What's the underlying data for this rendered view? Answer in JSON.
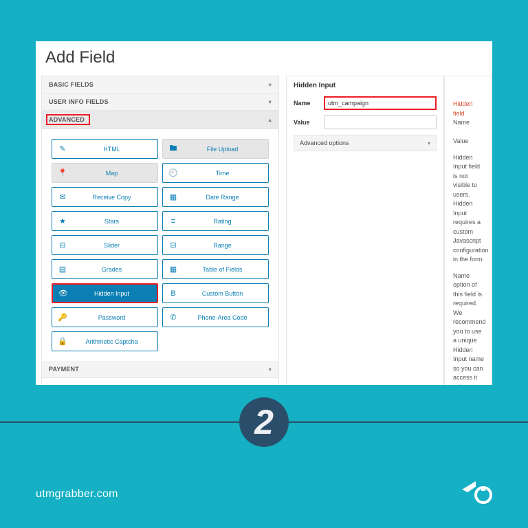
{
  "window": {
    "title": "Add Field"
  },
  "accordions": {
    "basic": "BASIC FIELDS",
    "user": "USER INFO FIELDS",
    "advanced": "ADVANCED",
    "payment": "PAYMENT"
  },
  "fields": [
    {
      "id": "html",
      "label": "HTML",
      "icon": "✎",
      "state": "normal"
    },
    {
      "id": "file",
      "label": "File Upload",
      "icon": "🖿",
      "state": "disabled"
    },
    {
      "id": "map",
      "label": "Map",
      "icon": "📍",
      "state": "disabled"
    },
    {
      "id": "time",
      "label": "Time",
      "icon": "🕘",
      "state": "normal"
    },
    {
      "id": "receive",
      "label": "Receive Copy",
      "icon": "✉",
      "state": "normal"
    },
    {
      "id": "daterange",
      "label": "Date Range",
      "icon": "▦",
      "state": "normal"
    },
    {
      "id": "stars",
      "label": "Stars",
      "icon": "★",
      "state": "normal"
    },
    {
      "id": "rating",
      "label": "Rating",
      "icon": "≡",
      "state": "normal"
    },
    {
      "id": "slider",
      "label": "Slider",
      "icon": "⊟",
      "state": "normal"
    },
    {
      "id": "range",
      "label": "Range",
      "icon": "⊟",
      "state": "normal"
    },
    {
      "id": "grades",
      "label": "Grades",
      "icon": "▤",
      "state": "normal"
    },
    {
      "id": "table",
      "label": "Table of Fields",
      "icon": "▦",
      "state": "normal"
    },
    {
      "id": "hidden",
      "label": "Hidden Input",
      "icon": "👁",
      "state": "selected"
    },
    {
      "id": "custombtn",
      "label": "Custom Button",
      "icon": "B",
      "state": "normal"
    },
    {
      "id": "password",
      "label": "Password",
      "icon": "🔑",
      "state": "normal"
    },
    {
      "id": "phone",
      "label": "Phone-Area Code",
      "icon": "✆",
      "state": "normal"
    },
    {
      "id": "captcha",
      "label": "Arithmetic Captcha",
      "icon": "🔒",
      "state": "normal"
    }
  ],
  "centerPanel": {
    "title": "Hidden Input",
    "nameLabel": "Name",
    "nameValue": "utm_campaign",
    "valueLabel": "Value",
    "valueValue": "",
    "advanced": "Advanced options"
  },
  "rightPanel": {
    "warn1": "Hidden field",
    "warn2a": "Name",
    "warn2b": "Value",
    "p1": "Hidden Input field is not visible to users. Hidden Input requires a custom Javascript configuration in the form.",
    "p2": "Name option of this field is required. We recommend you to use a unique Hidden Input name so you can access it using the editor on the page."
  },
  "footer": {
    "step": "2",
    "url": "utmgrabber.com"
  }
}
